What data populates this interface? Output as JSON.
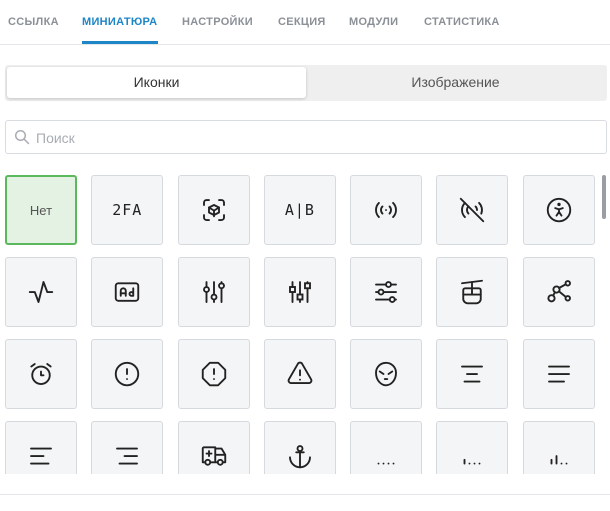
{
  "tabs": [
    {
      "label": "ССЫЛКА",
      "active": false
    },
    {
      "label": "МИНИАТЮРА",
      "active": true
    },
    {
      "label": "НАСТРОЙКИ",
      "active": false
    },
    {
      "label": "СЕКЦИЯ",
      "active": false
    },
    {
      "label": "МОДУЛИ",
      "active": false
    },
    {
      "label": "СТАТИСТИКА",
      "active": false
    }
  ],
  "segmented": {
    "icons_label": "Иконки",
    "image_label": "Изображение",
    "active": "icons"
  },
  "search": {
    "placeholder": "Поиск",
    "value": ""
  },
  "grid": {
    "none_label": "Нет",
    "twofa_label": "2FA",
    "ab_label": "A|B",
    "selected": "none"
  },
  "colors": {
    "accent": "#1d86c7",
    "selected_border": "#5cb85c",
    "selected_bg": "#e3f2e3",
    "cell_bg": "#f4f5f6"
  },
  "icons": [
    "none",
    "2fa-icon",
    "augmented-reality-icon",
    "ab-test-icon",
    "access-point-icon",
    "access-point-off-icon",
    "accessible-icon",
    "activity-icon",
    "ad-icon",
    "adjustments-icon",
    "adjustments-alt-icon",
    "adjustments-horizontal-icon",
    "aerial-lift-icon",
    "affiliate-icon",
    "alarm-icon",
    "alert-circle-icon",
    "alert-octagon-icon",
    "alert-triangle-icon",
    "alien-icon",
    "align-center-icon",
    "align-justified-icon",
    "align-left-icon",
    "align-right-icon",
    "ambulance-icon",
    "anchor-icon",
    "antenna-bars-1-icon",
    "antenna-bars-2-icon",
    "antenna-bars-3-icon"
  ]
}
